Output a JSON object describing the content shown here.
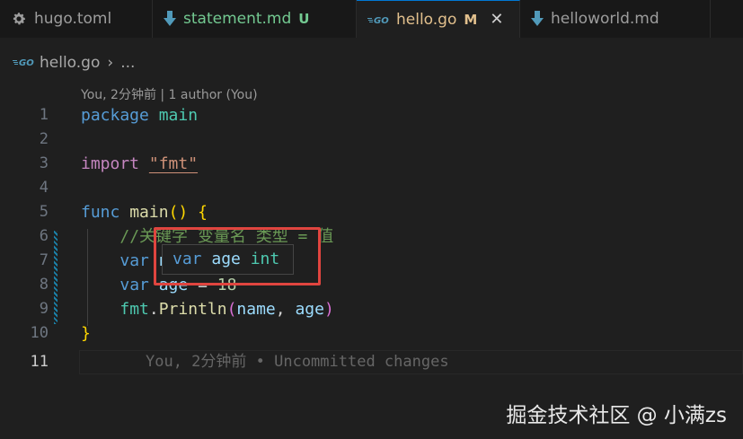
{
  "tabs": [
    {
      "label": "hugo.toml",
      "icon": "gear-icon",
      "status": ""
    },
    {
      "label": "statement.md",
      "icon": "markdown-download-icon",
      "status": "U"
    },
    {
      "label": "hello.go",
      "icon": "go-icon",
      "status": "M",
      "close": "✕"
    },
    {
      "label": "helloworld.md",
      "icon": "markdown-download-icon",
      "status": ""
    }
  ],
  "breadcrumb": {
    "file": "hello.go",
    "separator": "›",
    "more": "..."
  },
  "codelens": {
    "text": "You, 2分钟前 | 1 author (You)"
  },
  "code": {
    "lines": [
      {
        "n": "1"
      },
      {
        "n": "2"
      },
      {
        "n": "3"
      },
      {
        "n": "4"
      },
      {
        "n": "5"
      },
      {
        "n": "6"
      },
      {
        "n": "7"
      },
      {
        "n": "8"
      },
      {
        "n": "9"
      },
      {
        "n": "10"
      },
      {
        "n": "11"
      }
    ],
    "l1": {
      "kw": "package",
      "name": "main"
    },
    "l3": {
      "kw": "import",
      "pkg": "\"fmt\""
    },
    "l5": {
      "kw": "func",
      "name": "main",
      "parens": "()",
      "brace": "{"
    },
    "l6": {
      "comment": "//关键字 变量名 类型 = 值"
    },
    "l7": {
      "kw": "var",
      "rest": " name"
    },
    "l8": {
      "kw": "var",
      "name": "age",
      "op": " = ",
      "value": "18"
    },
    "l9": {
      "pkg": "fmt",
      "dot": ".",
      "fn": "Println",
      "open": "(",
      "a1": "name",
      "comma": ", ",
      "a2": "age",
      "close": ")"
    },
    "l10": {
      "brace": "}"
    },
    "blame": "You, 2分钟前 • Uncommitted changes"
  },
  "hover": {
    "kw": "var",
    "name": "age",
    "type": "int"
  },
  "watermark": "掘金技术社区 @ 小满zs",
  "colors": {
    "accent": "#0078d4",
    "highlight": "#e0453f",
    "modified": "#e2c08d",
    "untracked": "#73c991"
  }
}
